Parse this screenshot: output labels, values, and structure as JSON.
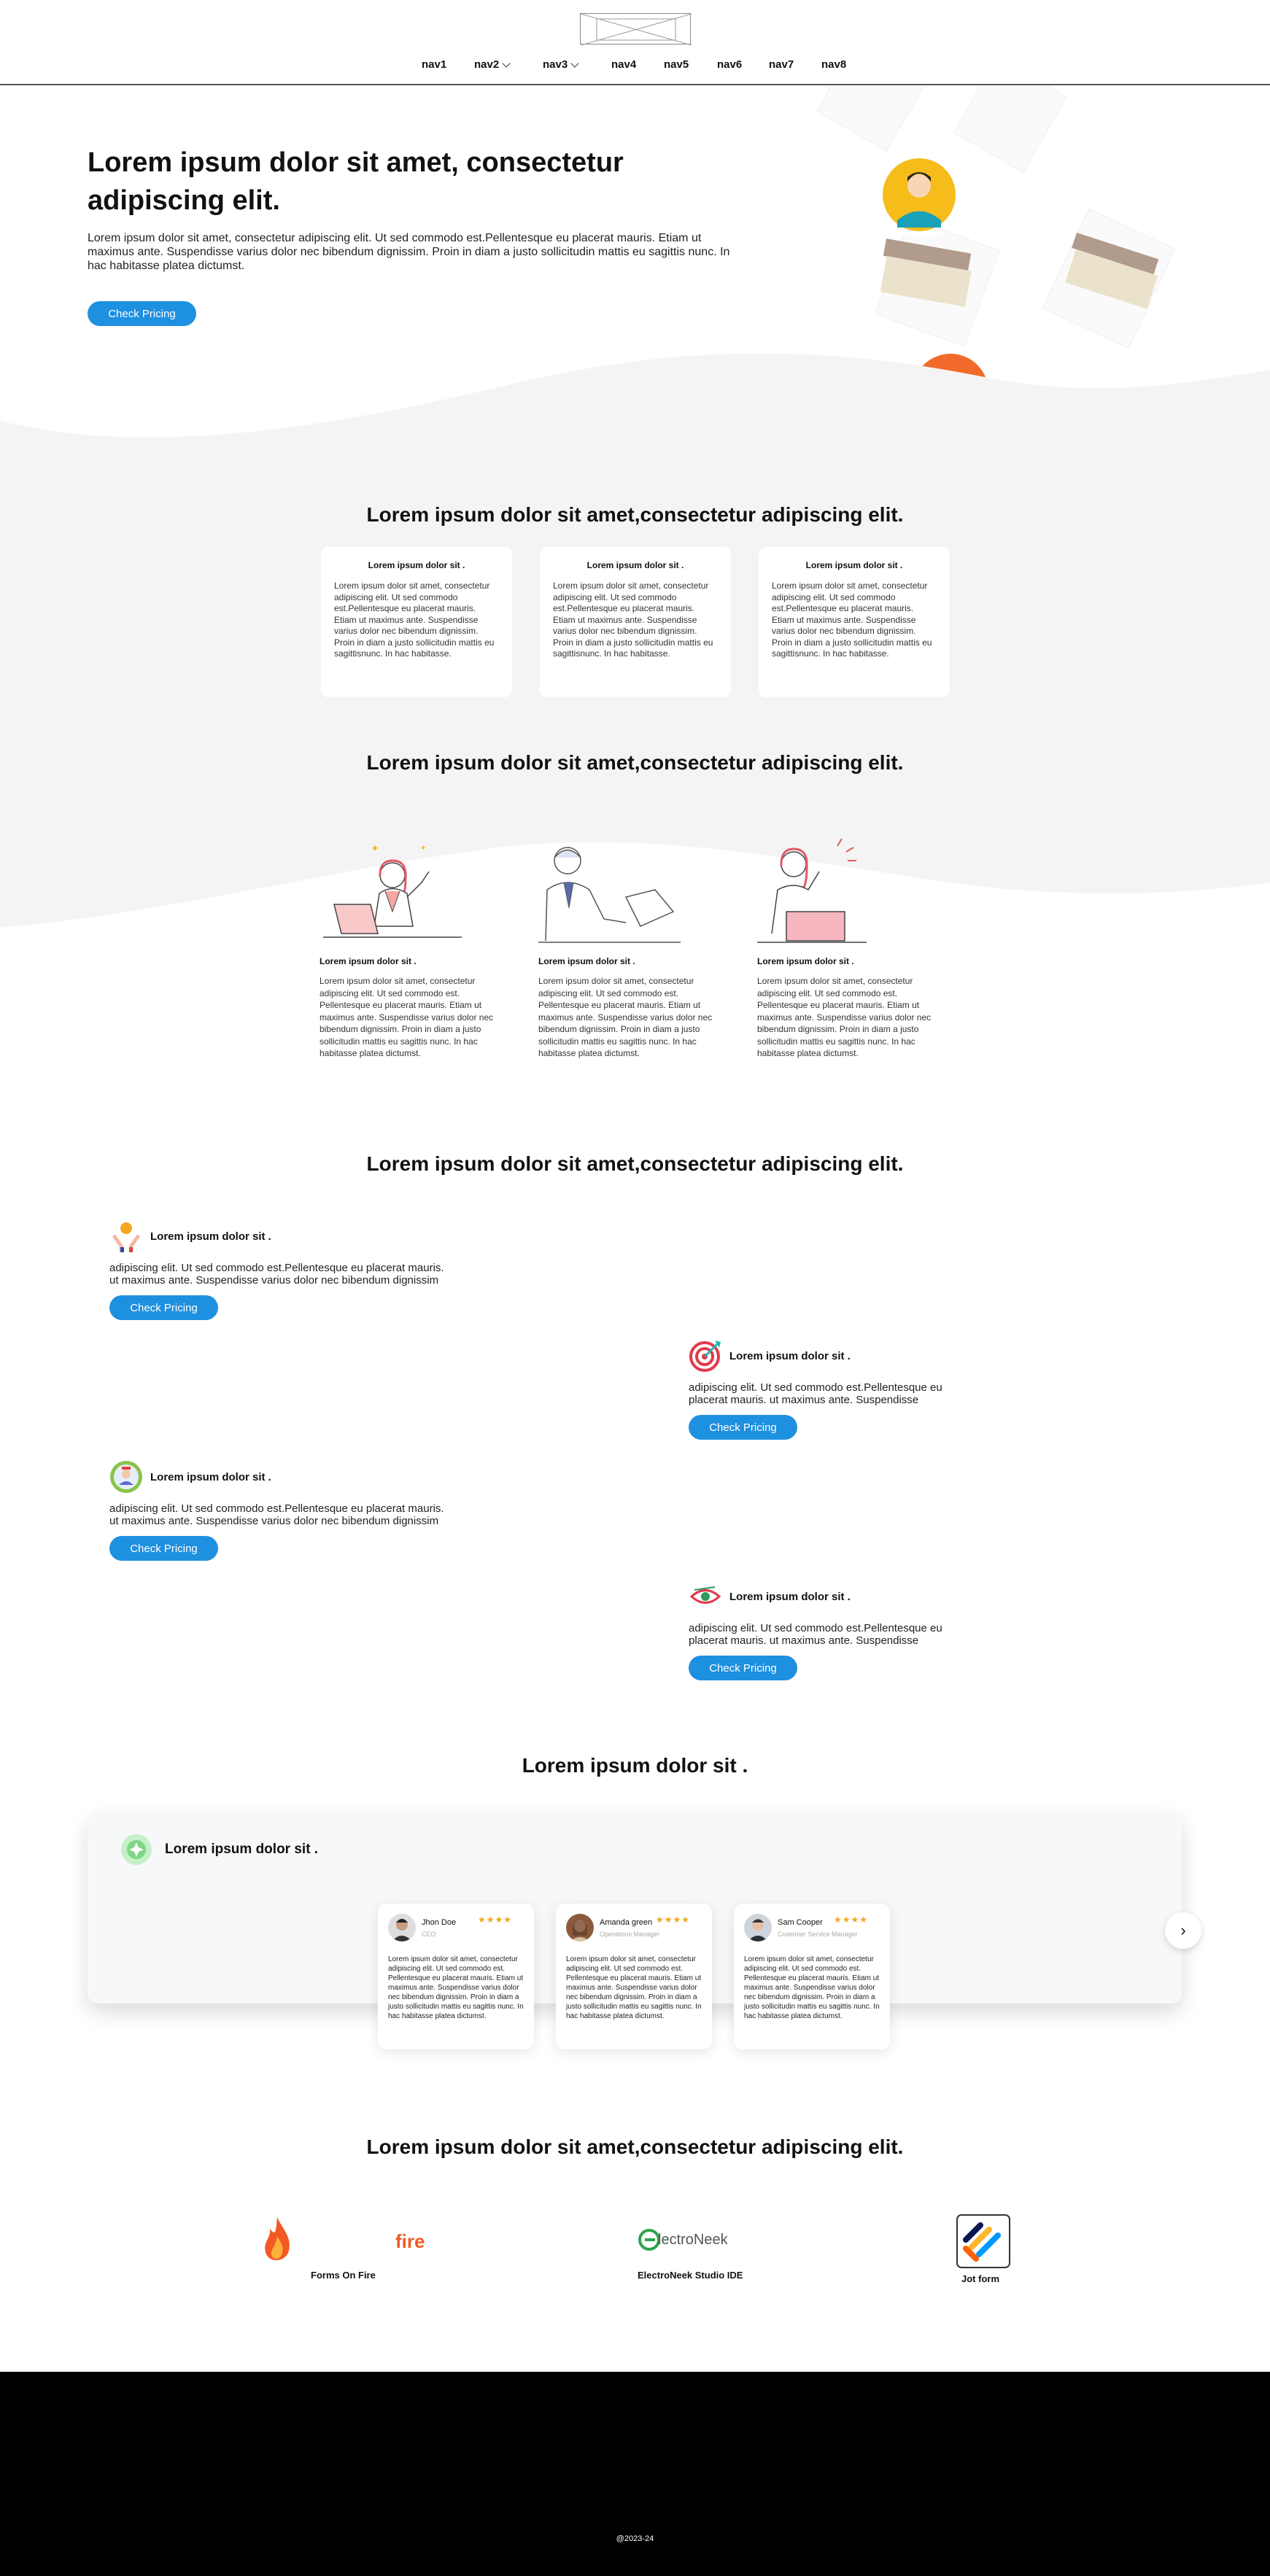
{
  "nav": {
    "items": [
      {
        "label": "nav1",
        "dropdown": false
      },
      {
        "label": "nav2",
        "dropdown": true
      },
      {
        "label": "nav3",
        "dropdown": true
      },
      {
        "label": "nav4",
        "dropdown": false
      },
      {
        "label": "nav5",
        "dropdown": false
      },
      {
        "label": "nav6",
        "dropdown": false
      },
      {
        "label": "nav7",
        "dropdown": false
      },
      {
        "label": "nav8",
        "dropdown": false
      }
    ]
  },
  "hero": {
    "title": "Lorem ipsum dolor sit amet, consectetur adipiscing elit.",
    "text": "Lorem ipsum dolor sit amet, consectetur adipiscing elit. Ut sed commodo est.Pellentesque eu placerat mauris. Etiam ut maximus ante. Suspendisse varius dolor nec bibendum dignissim. Proin in diam a justo sollicitudin mattis eu sagittis nunc. In hac habitasse platea dictumst.",
    "button": "Check Pricing"
  },
  "section1": {
    "title": "Lorem ipsum dolor sit amet,consectetur adipiscing elit.",
    "cards": [
      {
        "title": "Lorem ipsum dolor sit .",
        "text": "Lorem ipsum dolor sit amet, consectetur adipiscing elit. Ut sed commodo est.Pellentesque eu placerat mauris. Etiam ut maximus ante. Suspendisse varius dolor nec bibendum dignissim. Proin in diam a justo sollicitudin mattis eu sagittisnunc. In hac habitasse."
      },
      {
        "title": "Lorem ipsum dolor sit .",
        "text": "Lorem ipsum dolor sit amet, consectetur adipiscing elit. Ut sed commodo est.Pellentesque eu placerat mauris. Etiam ut maximus ante. Suspendisse varius dolor nec bibendum dignissim. Proin in diam a justo sollicitudin mattis eu sagittisnunc. In hac habitasse."
      },
      {
        "title": "Lorem ipsum dolor sit .",
        "text": "Lorem ipsum dolor sit amet, consectetur adipiscing elit. Ut sed commodo est.Pellentesque eu placerat mauris. Etiam ut maximus ante. Suspendisse varius dolor nec bibendum dignissim. Proin in diam a justo sollicitudin mattis eu sagittisnunc. In hac habitasse."
      }
    ]
  },
  "section2": {
    "title": "Lorem ipsum dolor sit amet,consectetur adipiscing elit.",
    "items": [
      {
        "title": "Lorem ipsum dolor sit .",
        "text": "Lorem ipsum dolor sit amet, consectetur adipiscing elit. Ut sed commodo est. Pellentesque eu placerat mauris. Etiam ut maximus ante. Suspendisse varius dolor nec bibendum dignissim. Proin in diam a justo sollicitudin mattis eu sagittis nunc. In hac habitasse platea dictumst."
      },
      {
        "title": "Lorem ipsum dolor sit .",
        "text": "Lorem ipsum dolor sit amet, consectetur adipiscing elit. Ut sed commodo est. Pellentesque eu placerat mauris. Etiam ut maximus ante. Suspendisse varius dolor nec bibendum dignissim. Proin in diam a justo sollicitudin mattis eu sagittis nunc. In hac habitasse platea dictumst."
      },
      {
        "title": "Lorem ipsum dolor sit .",
        "text": "Lorem ipsum dolor sit amet, consectetur adipiscing elit. Ut sed commodo est. Pellentesque eu placerat mauris. Etiam ut maximus ante. Suspendisse varius dolor nec bibendum dignissim. Proin in diam a justo sollicitudin mattis eu sagittis nunc. In hac habitasse platea dictumst."
      }
    ]
  },
  "section3": {
    "title": "Lorem ipsum dolor sit amet,consectetur adipiscing elit.",
    "features": [
      {
        "title": "Lorem ipsum dolor sit .",
        "text": "adipiscing elit. Ut sed commodo est.Pellentesque eu placerat mauris. ut maximus ante. Suspendisse varius dolor nec bibendum dignissim",
        "button": "Check Pricing",
        "icon": "hands-award-icon"
      },
      {
        "title": "Lorem ipsum dolor sit .",
        "text": "adipiscing elit. Ut sed commodo est.Pellentesque eu placerat mauris. ut maximus ante. Suspendisse",
        "button": "Check Pricing",
        "icon": "target-icon"
      },
      {
        "title": "Lorem ipsum dolor sit .",
        "text": "adipiscing elit. Ut sed commodo est.Pellentesque eu placerat mauris. ut maximus ante. Suspendisse varius dolor nec bibendum dignissim",
        "button": "Check Pricing",
        "icon": "user-badge-icon"
      },
      {
        "title": "Lorem ipsum dolor sit .",
        "text": "adipiscing elit. Ut sed commodo est.Pellentesque eu placerat mauris. ut maximus ante. Suspendisse",
        "button": "Check Pricing",
        "icon": "eye-icon"
      }
    ]
  },
  "testimonials": {
    "title": "Lorem ipsum dolor sit .",
    "panel_title": "Lorem ipsum dolor sit .",
    "cards": [
      {
        "name": "Jhon Doe",
        "role": "CEO",
        "stars": "★★★★",
        "text": "Lorem ipsum dolor sit amet, consectetur adipiscing elit. Ut sed commodo est. Pellentesque eu placerat mauris. Etiam ut maximus ante. Suspendisse varius dolor nec bibendum dignissim. Proin in diam a justo sollicitudin mattis eu sagittis nunc. In hac habitasse platea dictumst."
      },
      {
        "name": "Amanda green",
        "role": "Operations Manager",
        "stars": "★★★★",
        "text": "Lorem ipsum dolor sit amet, consectetur adipiscing elit. Ut sed commodo est. Pellentesque eu placerat mauris. Etiam ut maximus ante. Suspendisse varius dolor nec bibendum dignissim. Proin in diam a justo sollicitudin mattis eu sagittis nunc. In hac habitasse platea dictumst."
      },
      {
        "name": "Sam Cooper",
        "role": "Customer Service Manager",
        "stars": "★★★★",
        "text": "Lorem ipsum dolor sit amet, consectetur adipiscing elit. Ut sed commodo est. Pellentesque eu placerat mauris. Etiam ut maximus ante. Suspendisse varius dolor nec bibendum dignissim. Proin in diam a justo sollicitudin mattis eu sagittis nunc. In hac habitasse platea dictumst."
      }
    ],
    "next_label": "›"
  },
  "integrations": {
    "title": "Lorem ipsum dolor sit amet,consectetur adipiscing elit.",
    "items": [
      {
        "name": "Forms On Fire",
        "logo_text": "fire"
      },
      {
        "name": "ElectroNeek Studio IDE",
        "logo_text": "lectroNeek"
      },
      {
        "name": "Jot form",
        "logo_text": ""
      }
    ]
  },
  "footer": {
    "copyright": "@2023-24"
  },
  "colors": {
    "accent": "#1e90e0",
    "section_gray": "#f4f4f4",
    "star": "#f3a51d",
    "footer": "#000000"
  }
}
